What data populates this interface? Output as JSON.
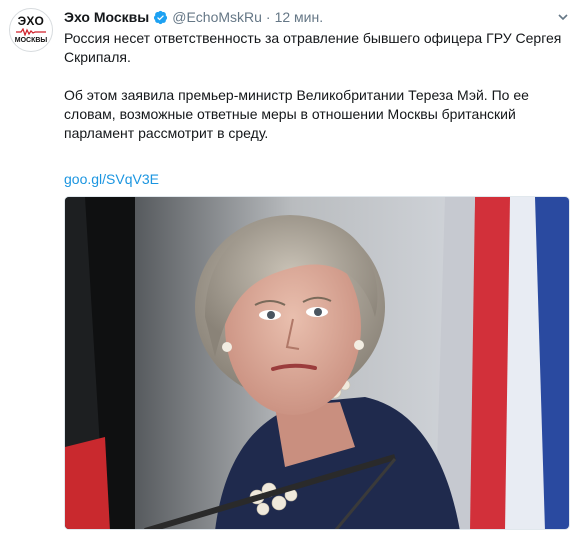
{
  "tweet": {
    "author_name": "Эхо Москвы",
    "handle": "@EchoMskRu",
    "separator": "·",
    "time": "12 мин.",
    "verified": true,
    "avatar": {
      "line1": "ЭХО",
      "line2": "МОСКВЫ"
    },
    "paragraphs": [
      "Россия несет ответственность за отравление бывшего офицера ГРУ Сергея Скрипаля.",
      "Об этом заявила премьер-министр Великобритании Тереза Мэй. По ее словам, возможные ответные меры в отношении Москвы британский парламент рассмотрит в среду."
    ],
    "link": "goo.gl/SVqV3E"
  },
  "colors": {
    "text": "#14171a",
    "muted": "#657786",
    "link": "#1b95e0",
    "verified": "#1da1f2"
  },
  "icons": {
    "verified": "verified-badge-icon",
    "caret": "chevron-down-icon"
  }
}
